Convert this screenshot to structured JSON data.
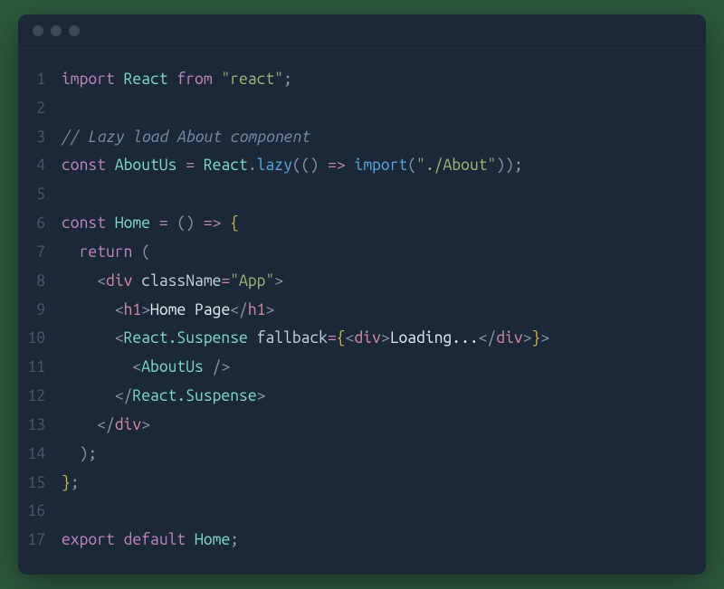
{
  "window": {
    "traffic_lights": [
      "dot1",
      "dot2",
      "dot3"
    ]
  },
  "colors": {
    "background_outer": "#2d5a3d",
    "background_window": "#1b2837",
    "lineno": "#4a5870",
    "keyword": "#c586c0",
    "type": "#7fdbca",
    "function": "#5aa8e0",
    "string": "#9db97a",
    "comment": "#7a8da8",
    "punct": "#8896ae",
    "tag": "#d88ca3",
    "brace": "#d0b84a",
    "text": "#e8ecf3"
  },
  "code": {
    "language": "javascript",
    "lines": [
      {
        "n": 1,
        "tokens": [
          [
            "kw",
            "import"
          ],
          [
            "text",
            " "
          ],
          [
            "type",
            "React"
          ],
          [
            "text",
            " "
          ],
          [
            "kw",
            "from"
          ],
          [
            "text",
            " "
          ],
          [
            "str",
            "\"react\""
          ],
          [
            "punct",
            ";"
          ]
        ]
      },
      {
        "n": 2,
        "tokens": []
      },
      {
        "n": 3,
        "tokens": [
          [
            "comment",
            "// Lazy load About component"
          ]
        ]
      },
      {
        "n": 4,
        "tokens": [
          [
            "kw",
            "const"
          ],
          [
            "text",
            " "
          ],
          [
            "type",
            "AboutUs"
          ],
          [
            "text",
            " "
          ],
          [
            "op",
            "="
          ],
          [
            "text",
            " "
          ],
          [
            "type",
            "React"
          ],
          [
            "punct",
            "."
          ],
          [
            "fn",
            "lazy"
          ],
          [
            "punct",
            "(()"
          ],
          [
            "text",
            " "
          ],
          [
            "op",
            "=>"
          ],
          [
            "text",
            " "
          ],
          [
            "fn",
            "import"
          ],
          [
            "punct",
            "("
          ],
          [
            "str",
            "\"./About\""
          ],
          [
            "punct",
            "));"
          ]
        ]
      },
      {
        "n": 5,
        "tokens": []
      },
      {
        "n": 6,
        "tokens": [
          [
            "kw",
            "const"
          ],
          [
            "text",
            " "
          ],
          [
            "type",
            "Home"
          ],
          [
            "text",
            " "
          ],
          [
            "op",
            "="
          ],
          [
            "text",
            " "
          ],
          [
            "punct",
            "()"
          ],
          [
            "text",
            " "
          ],
          [
            "op",
            "=>"
          ],
          [
            "text",
            " "
          ],
          [
            "brace",
            "{"
          ]
        ]
      },
      {
        "n": 7,
        "tokens": [
          [
            "text",
            "  "
          ],
          [
            "kw",
            "return"
          ],
          [
            "text",
            " "
          ],
          [
            "punct",
            "("
          ]
        ]
      },
      {
        "n": 8,
        "tokens": [
          [
            "text",
            "    "
          ],
          [
            "angle",
            "<"
          ],
          [
            "tag",
            "div"
          ],
          [
            "text",
            " "
          ],
          [
            "attr",
            "className"
          ],
          [
            "op",
            "="
          ],
          [
            "str",
            "\"App\""
          ],
          [
            "angle",
            ">"
          ]
        ]
      },
      {
        "n": 9,
        "tokens": [
          [
            "text",
            "      "
          ],
          [
            "angle",
            "<"
          ],
          [
            "tag",
            "h1"
          ],
          [
            "angle",
            ">"
          ],
          [
            "text",
            "Home Page"
          ],
          [
            "angle",
            "</"
          ],
          [
            "tag",
            "h1"
          ],
          [
            "angle",
            ">"
          ]
        ]
      },
      {
        "n": 10,
        "tokens": [
          [
            "text",
            "      "
          ],
          [
            "angle",
            "<"
          ],
          [
            "comp",
            "React.Suspense"
          ],
          [
            "text",
            " "
          ],
          [
            "attr",
            "fallback"
          ],
          [
            "op",
            "="
          ],
          [
            "brace",
            "{"
          ],
          [
            "angle",
            "<"
          ],
          [
            "tag",
            "div"
          ],
          [
            "angle",
            ">"
          ],
          [
            "text",
            "Loading..."
          ],
          [
            "angle",
            "</"
          ],
          [
            "tag",
            "div"
          ],
          [
            "angle",
            ">"
          ],
          [
            "brace",
            "}"
          ],
          [
            "angle",
            ">"
          ]
        ]
      },
      {
        "n": 11,
        "tokens": [
          [
            "text",
            "        "
          ],
          [
            "angle",
            "<"
          ],
          [
            "comp",
            "AboutUs"
          ],
          [
            "text",
            " "
          ],
          [
            "angle",
            "/>"
          ]
        ]
      },
      {
        "n": 12,
        "tokens": [
          [
            "text",
            "      "
          ],
          [
            "angle",
            "</"
          ],
          [
            "comp",
            "React.Suspense"
          ],
          [
            "angle",
            ">"
          ]
        ]
      },
      {
        "n": 13,
        "tokens": [
          [
            "text",
            "    "
          ],
          [
            "angle",
            "</"
          ],
          [
            "tag",
            "div"
          ],
          [
            "angle",
            ">"
          ]
        ]
      },
      {
        "n": 14,
        "tokens": [
          [
            "text",
            "  "
          ],
          [
            "punct",
            ");"
          ]
        ]
      },
      {
        "n": 15,
        "tokens": [
          [
            "brace",
            "}"
          ],
          [
            "punct",
            ";"
          ]
        ]
      },
      {
        "n": 16,
        "tokens": []
      },
      {
        "n": 17,
        "tokens": [
          [
            "kw",
            "export"
          ],
          [
            "text",
            " "
          ],
          [
            "kw",
            "default"
          ],
          [
            "text",
            " "
          ],
          [
            "type",
            "Home"
          ],
          [
            "punct",
            ";"
          ]
        ]
      }
    ]
  }
}
